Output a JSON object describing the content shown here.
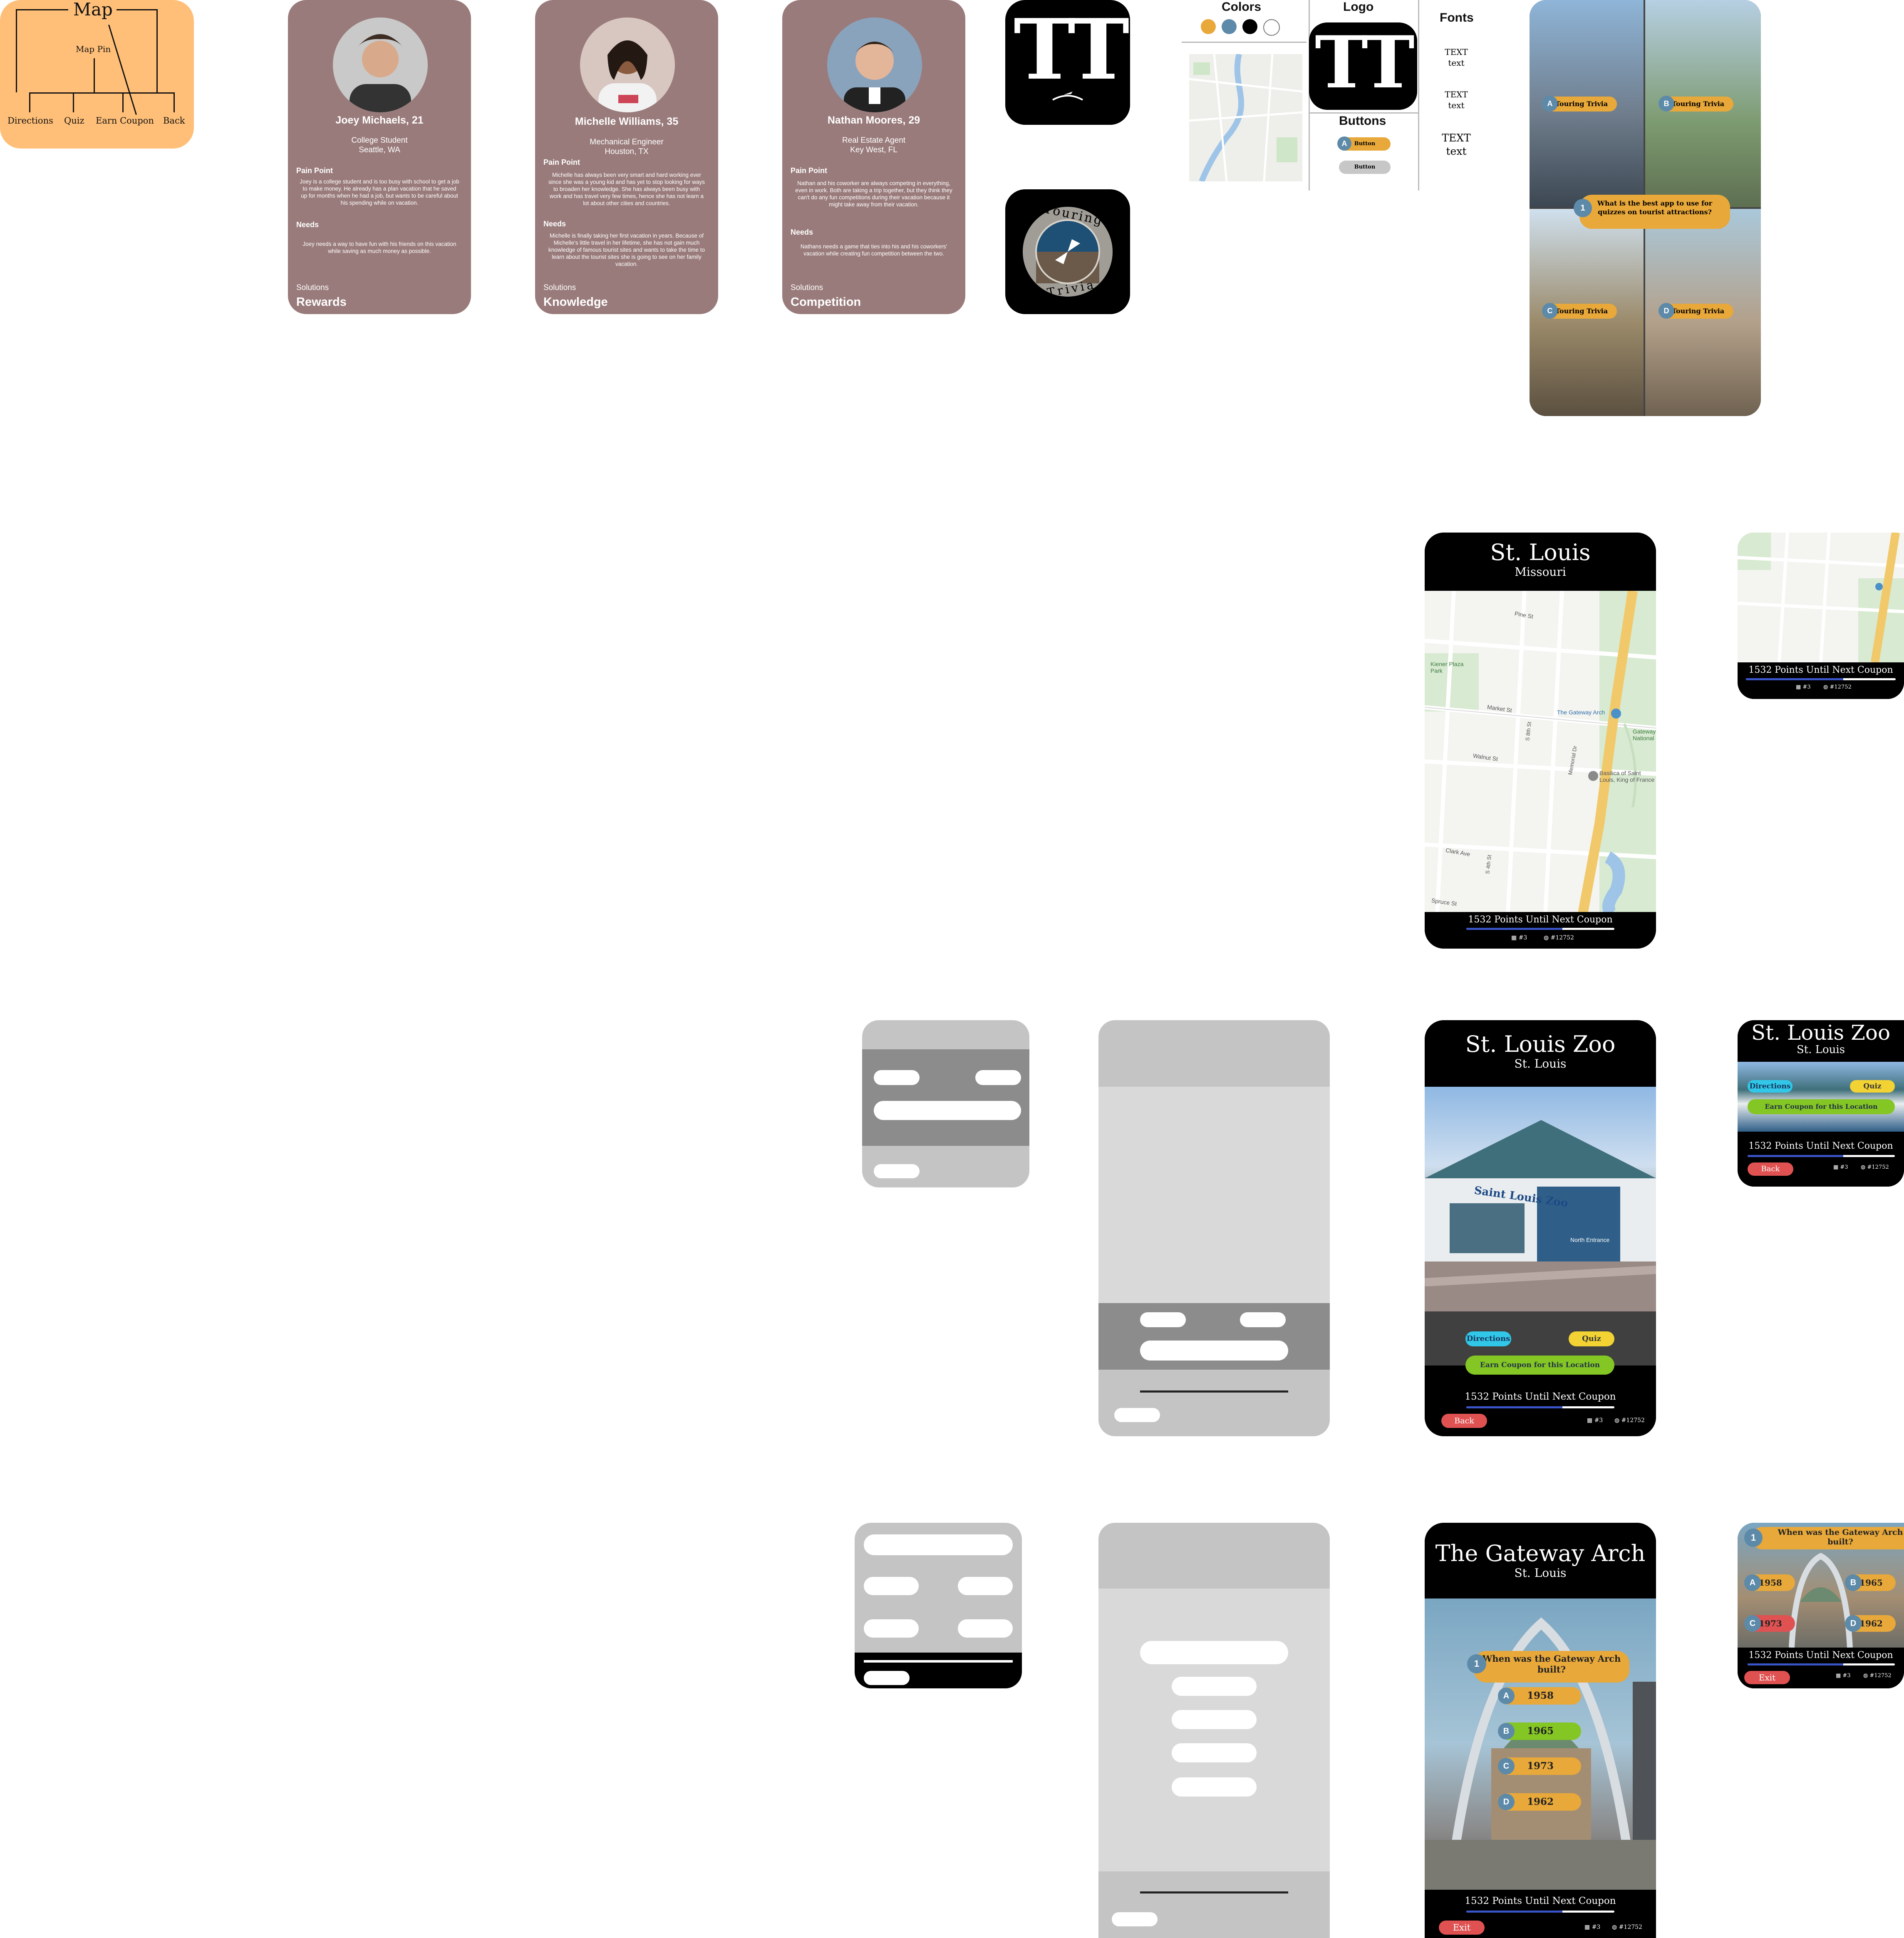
{
  "flow": {
    "title": "Map",
    "pin": "Map Pin",
    "items": [
      "Directions",
      "Quiz",
      "Earn Coupon",
      "Back"
    ]
  },
  "personas": [
    {
      "name": "Joey Michaels, 21",
      "role": "College Student",
      "location": "Seattle, WA",
      "pain_label": "Pain Point",
      "pain": "Joey is a college student and is too busy with school to get a job to make money. He already has a plan vacation that he saved up for months when he had a job, but wants to be careful about his spending while on vacation.",
      "needs_label": "Needs",
      "needs": "Joey needs a way to have fun with his friends on this vacation while saving as much money as possible.",
      "solutions_label": "Solutions",
      "solution": "Rewards"
    },
    {
      "name": "Michelle Williams, 35",
      "role": "Mechanical Engineer",
      "location": "Houston, TX",
      "pain_label": "Pain Point",
      "pain": "Michelle has always been very smart and hard working ever since she was a young kid and has yet to stop looking for ways to broaden her knowledge. She has always been busy with work and has travel very few times, hence she has not learn a lot about other cities and countries.",
      "needs_label": "Needs",
      "needs": "Michelle is finally taking her first vacation in years. Because of Michelle's little travel in her lifetime, she has not gain much knowledge of famous tourist sites and wants to take the time to learn about the tourist sites she is going to see on her family vacation.",
      "solutions_label": "Solutions",
      "solution": "Knowledge"
    },
    {
      "name": "Nathan Moores, 29",
      "role": "Real Estate Agent",
      "location": "Key West, FL",
      "pain_label": "Pain Point",
      "pain": "Nathan and his coworker are always competing in everything, even in work. Both are taking a trip together, but they think they can't do any fun competitions during their vacation because it might take away from their vacation.",
      "needs_label": "Needs",
      "needs": "Nathans needs a game that ties into his and his coworkers' vacation while creating fun competition between the two.",
      "solutions_label": "Solutions",
      "solution": "Competition"
    }
  ],
  "logo": {
    "tt": "TT",
    "touring": "Touring",
    "trivia": "Trivia"
  },
  "style_guide": {
    "colors_label": "Colors",
    "colors": [
      "#e8a83a",
      "#5d8aa8",
      "#000000",
      "#ffffff"
    ],
    "logo_label": "Logo",
    "fonts_label": "Fonts",
    "font_samples": [
      {
        "a": "TEXT",
        "b": "text"
      },
      {
        "a": "TEXT",
        "b": "text"
      },
      {
        "a": "TEXT",
        "b": "text"
      }
    ],
    "buttons_label": "Buttons",
    "button_letter": "A",
    "button_primary": "Button",
    "button_secondary": "Button"
  },
  "marketing": {
    "brand": "Touring Trivia",
    "tiles": [
      {
        "letter": "A",
        "label": "Touring Trivia"
      },
      {
        "letter": "B",
        "label": "Touring Trivia"
      },
      {
        "letter": "C",
        "label": "Touring Trivia"
      },
      {
        "letter": "D",
        "label": "Touring Trivia"
      }
    ],
    "question_number": "1",
    "question": "What is the best app to use for quizzes on tourist attractions?"
  },
  "status": {
    "points": "1532 Points Until Next Coupon",
    "coupons": "3",
    "score": "12752",
    "progress": 0.65
  },
  "map_screen": {
    "title": "St. Louis",
    "subtitle": "Missouri",
    "streets": [
      "Pine St",
      "Market St",
      "Walnut St",
      "Clark Ave",
      "Spruce St",
      "S 8th St",
      "S 4th St",
      "Memorial Dr"
    ],
    "places": [
      "Kiener Plaza Park",
      "The Gateway Arch",
      "Gateway National",
      "Basilica of Saint Louis, King of France"
    ]
  },
  "zoo_screen": {
    "title": "St. Louis Zoo",
    "subtitle": "St. Louis",
    "sign": "Saint Louis Zoo",
    "entrance": "North Entrance",
    "directions": "Directions",
    "quiz": "Quiz",
    "coupon": "Earn Coupon for this Location",
    "back": "Back"
  },
  "arch_screen": {
    "title": "The Gateway Arch",
    "subtitle": "St. Louis",
    "question_number": "1",
    "question": "When was the Gateway Arch built?",
    "options": [
      {
        "letter": "A",
        "value": "1958",
        "state": "normal"
      },
      {
        "letter": "B",
        "value": "1965",
        "state": "correct"
      },
      {
        "letter": "C",
        "value": "1973",
        "state": "normal"
      },
      {
        "letter": "D",
        "value": "1962",
        "state": "normal"
      }
    ],
    "exit": "Exit"
  },
  "small_arch": {
    "options": [
      {
        "letter": "A",
        "value": "1958",
        "state": "normal"
      },
      {
        "letter": "B",
        "value": "1965",
        "state": "normal"
      },
      {
        "letter": "C",
        "value": "1973",
        "state": "wrong"
      },
      {
        "letter": "D",
        "value": "1962",
        "state": "normal"
      }
    ]
  }
}
